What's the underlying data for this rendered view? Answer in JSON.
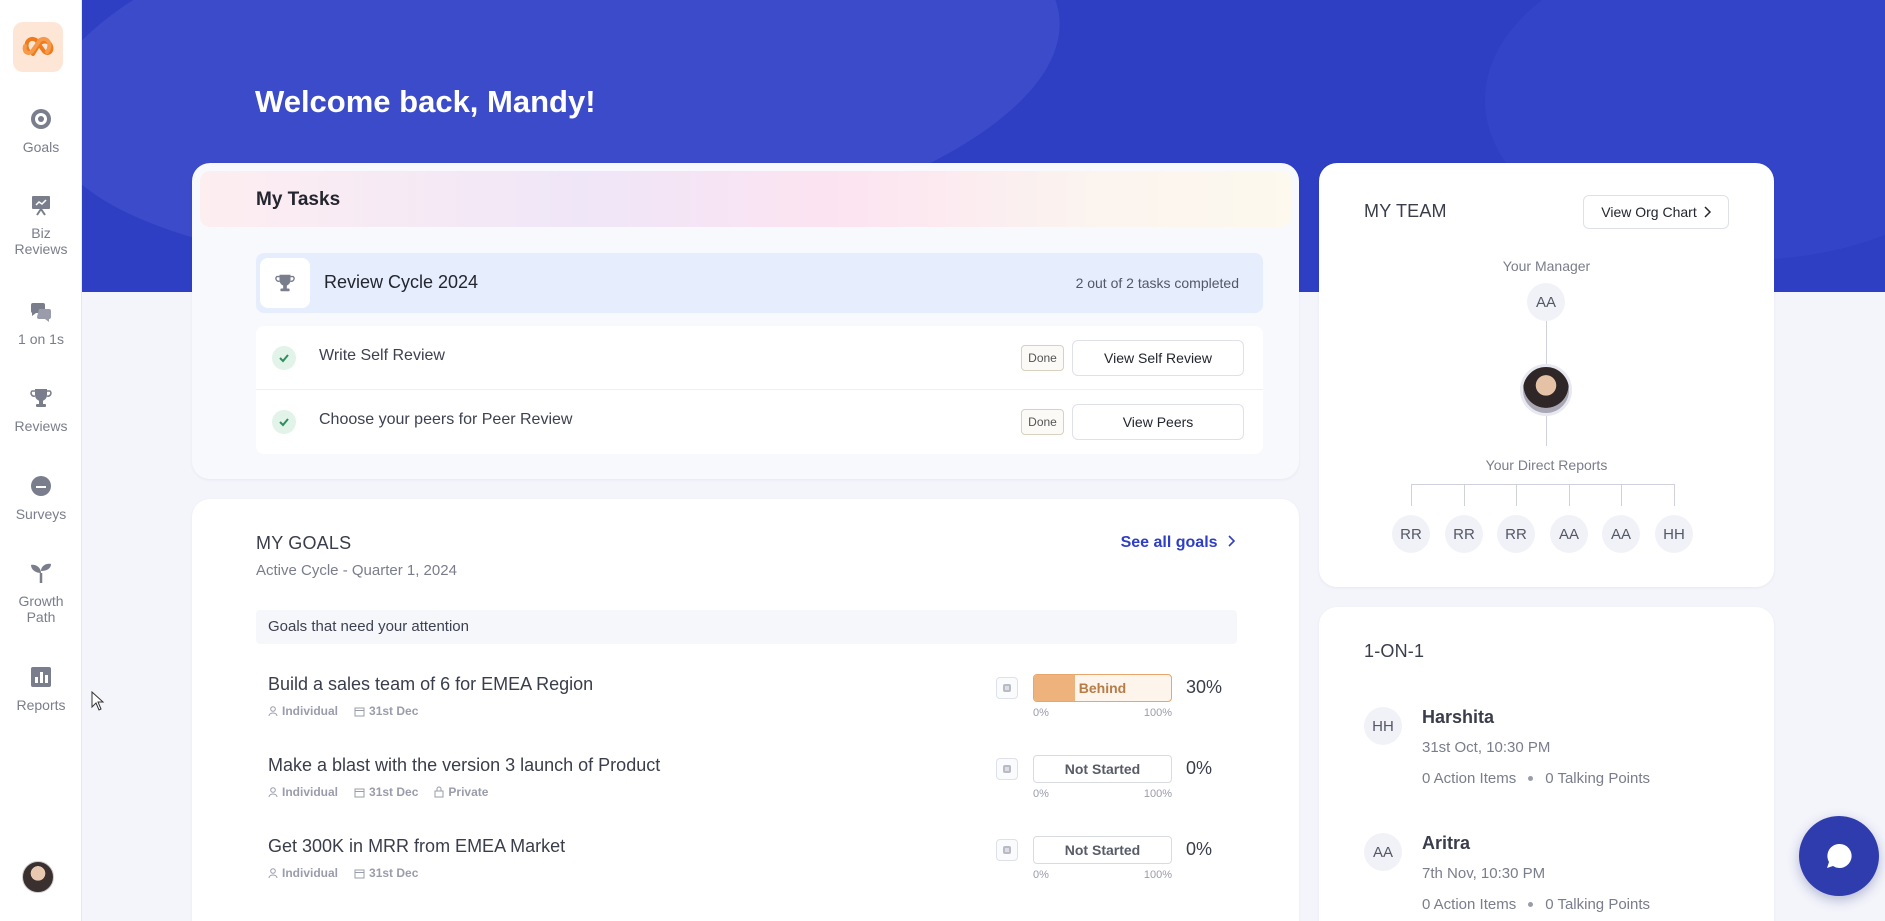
{
  "sidebar": {
    "items": [
      {
        "label": "Goals",
        "icon": "target-icon"
      },
      {
        "label": "Biz\nReviews",
        "icon": "presentation-icon"
      },
      {
        "label": "1 on 1s",
        "icon": "chat-bubbles-icon"
      },
      {
        "label": "Reviews",
        "icon": "trophy-icon"
      },
      {
        "label": "Surveys",
        "icon": "survey-icon"
      },
      {
        "label": "Growth\nPath",
        "icon": "sprout-icon"
      },
      {
        "label": "Reports",
        "icon": "bar-chart-icon"
      }
    ]
  },
  "header": {
    "welcome": "Welcome back, Mandy!"
  },
  "tasks": {
    "title": "My Tasks",
    "cycle": {
      "name": "Review Cycle 2024",
      "status": "2 out of 2 tasks completed"
    },
    "items": [
      {
        "label": "Write Self Review",
        "badge": "Done",
        "action": "View Self Review"
      },
      {
        "label": "Choose your peers for Peer Review",
        "badge": "Done",
        "action": "View Peers"
      }
    ]
  },
  "goals": {
    "title": "MY GOALS",
    "subtitle": "Active Cycle - Quarter 1, 2024",
    "see_all": "See all goals",
    "attention_label": "Goals that need your attention",
    "scale_min": "0%",
    "scale_max": "100%",
    "items": [
      {
        "name": "Build a sales team of 6 for EMEA Region",
        "type": "Individual",
        "due": "31st Dec",
        "status": "Behind",
        "progress": 30,
        "percent_label": "30%",
        "private": ""
      },
      {
        "name": "Make a blast with the version 3 launch of Product",
        "type": "Individual",
        "due": "31st Dec",
        "status": "Not Started",
        "progress": 0,
        "percent_label": "0%",
        "private": "Private"
      },
      {
        "name": "Get 300K in MRR from EMEA Market",
        "type": "Individual",
        "due": "31st Dec",
        "status": "Not Started",
        "progress": 0,
        "percent_label": "0%",
        "private": ""
      }
    ]
  },
  "team": {
    "title": "MY TEAM",
    "org_button": "View Org Chart",
    "manager_caption": "Your Manager",
    "manager_initials": "AA",
    "reports_caption": "Your Direct Reports",
    "reports": [
      "RR",
      "RR",
      "RR",
      "AA",
      "AA",
      "HH"
    ]
  },
  "one_on_one": {
    "title": "1-ON-1",
    "people": [
      {
        "initials": "HH",
        "name": "Harshita",
        "time": "31st Oct, 10:30 PM",
        "action_items": "0 Action Items",
        "talking_points": "0 Talking Points"
      },
      {
        "initials": "AA",
        "name": "Aritra",
        "time": "7th Nov, 10:30 PM",
        "action_items": "0 Action Items",
        "talking_points": "0 Talking Points"
      }
    ]
  },
  "colors": {
    "brand": "#2f3fc4",
    "behind": "#eeb27d",
    "done_check": "#2f8f5c"
  }
}
